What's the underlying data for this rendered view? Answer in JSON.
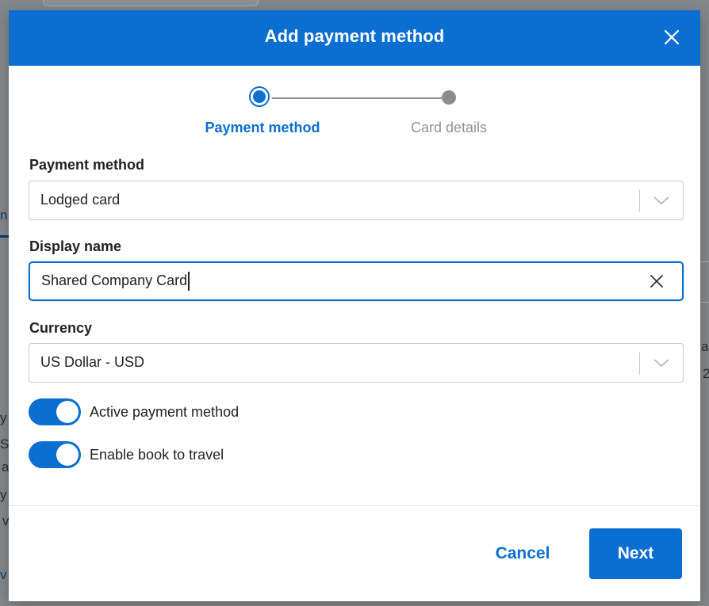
{
  "background": {
    "fragments": [
      "n",
      "a",
      "2",
      "y",
      "S",
      "a",
      "y",
      "v",
      "v"
    ]
  },
  "modal": {
    "title": "Add payment method",
    "close_icon": "close-icon"
  },
  "stepper": {
    "steps": [
      {
        "label": "Payment method",
        "state": "active"
      },
      {
        "label": "Card details",
        "state": "inactive"
      }
    ]
  },
  "form": {
    "payment_method": {
      "label": "Payment method",
      "value": "Lodged card"
    },
    "display_name": {
      "label": "Display name",
      "value": "Shared Company Card"
    },
    "currency": {
      "label": "Currency",
      "value": "US Dollar - USD"
    },
    "toggles": [
      {
        "label": "Active payment method",
        "on": true
      },
      {
        "label": "Enable book to travel",
        "on": true
      }
    ]
  },
  "footer": {
    "cancel_label": "Cancel",
    "next_label": "Next"
  },
  "colors": {
    "primary": "#0a6fd1",
    "overlay": "#858789",
    "text": "#222222",
    "muted": "#8f9295"
  }
}
